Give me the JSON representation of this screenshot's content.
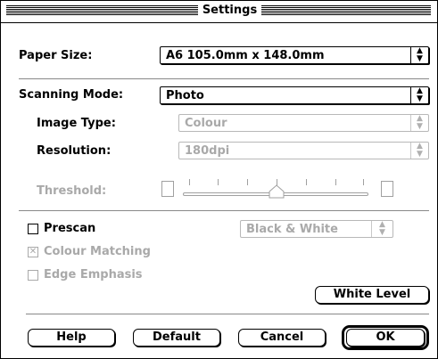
{
  "window": {
    "title": "Settings"
  },
  "paper_size": {
    "label": "Paper Size:",
    "value": "A6  105.0mm x 148.0mm"
  },
  "scanning_mode": {
    "label": "Scanning Mode:",
    "value": "Photo"
  },
  "image_type": {
    "label": "Image Type:",
    "value": "Colour"
  },
  "resolution": {
    "label": "Resolution:",
    "value": "180dpi"
  },
  "threshold": {
    "label": "Threshold:"
  },
  "prescan": {
    "label": "Prescan",
    "checked": false
  },
  "prescan_mode": {
    "value": "Black & White"
  },
  "colour_matching": {
    "label": "Colour Matching",
    "checked": true
  },
  "edge_emphasis": {
    "label": "Edge Emphasis",
    "checked": false
  },
  "buttons": {
    "white_level": "White Level",
    "help": "Help",
    "default": "Default",
    "cancel": "Cancel",
    "ok": "OK"
  },
  "icons": {
    "popup_arrow": "up-down-arrows-icon",
    "check_mark": "x-check-icon",
    "slider_thumb": "slider-thumb-icon"
  }
}
